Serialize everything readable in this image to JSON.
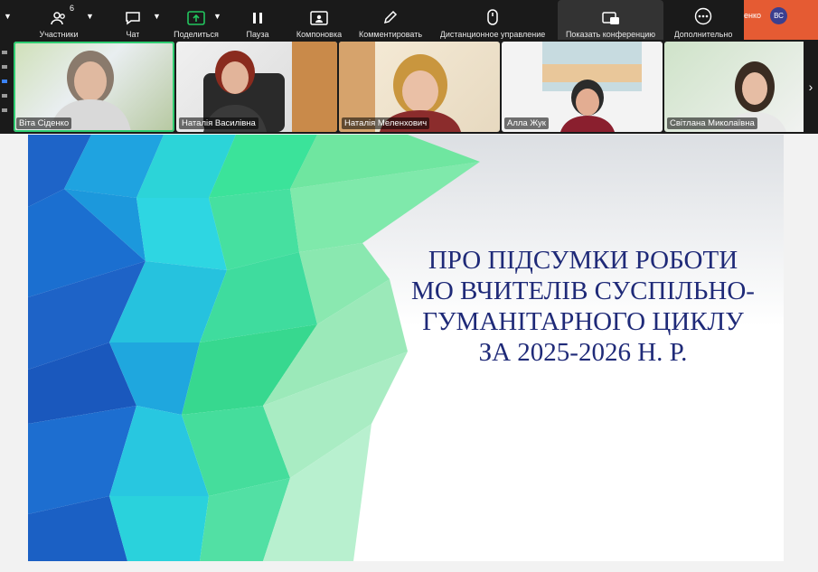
{
  "toolbar": {
    "participants_count": "6",
    "buttons": [
      {
        "label": "Участники"
      },
      {
        "label": "Чат"
      },
      {
        "label": "Поделиться"
      },
      {
        "label": "Пауза"
      },
      {
        "label": "Компоновка"
      },
      {
        "label": "Комментировать"
      },
      {
        "label": "Дистанционное управление"
      },
      {
        "label": "Показать конференцию"
      },
      {
        "label": "Дополнительно"
      }
    ],
    "user_name_fragment": "енко",
    "user_initials": "ВС"
  },
  "participants": [
    {
      "name": "Віта Сіденко"
    },
    {
      "name": "Наталія Василівна"
    },
    {
      "name": "Наталія Меленхович"
    },
    {
      "name": "Алла Жук"
    },
    {
      "name": "Світлана Миколаївна"
    }
  ],
  "slide": {
    "title_lines": [
      "ПРО ПІДСУМКИ РОБОТИ",
      "МО ВЧИТЕЛІВ СУСПІЛЬНО-",
      "ГУМАНІТАРНОГО ЦИКЛУ",
      "ЗА 2025-2026 Н. Р."
    ]
  },
  "colors": {
    "toolbar_bg": "#1a1a1a",
    "accent_green": "#2ecc71",
    "share_green": "#22c55e",
    "title_navy": "#1f2a78",
    "user_strip": "#e55b33"
  }
}
